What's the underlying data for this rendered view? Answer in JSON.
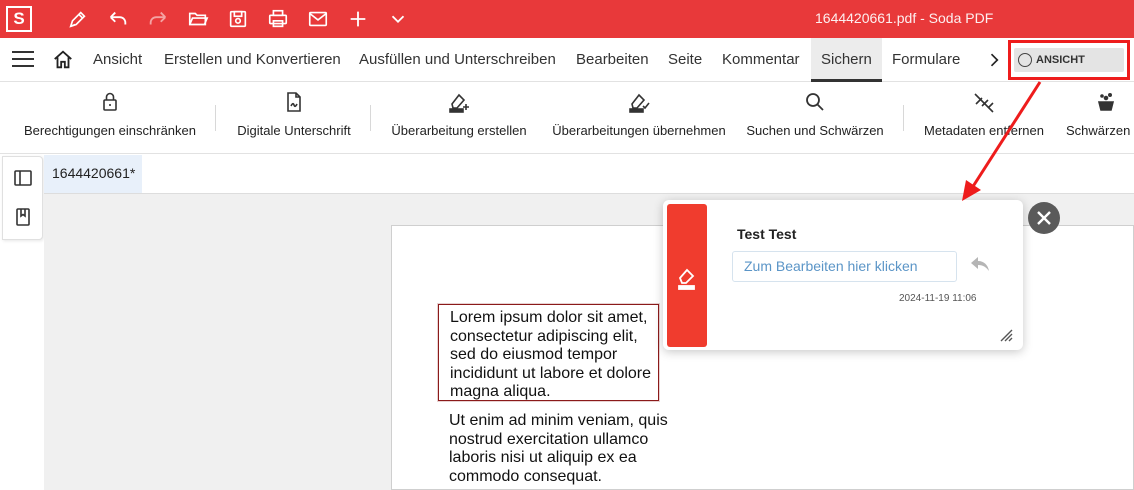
{
  "app": {
    "logo_letter": "S",
    "window_title": "1644420661.pdf  -  Soda PDF",
    "titlebar_color": "#e8393a",
    "quick_access_icons": [
      "pen-icon",
      "undo-icon",
      "redo-icon",
      "open-folder-icon",
      "save-icon",
      "print-icon",
      "mail-icon",
      "add-icon",
      "chevron-down-icon"
    ]
  },
  "menubar": {
    "tabs": [
      "Ansicht",
      "Erstellen und Konvertieren",
      "Ausfüllen und Unterschreiben",
      "Bearbeiten",
      "Seite",
      "Kommentar",
      "Sichern",
      "Formulare"
    ],
    "active_tab": "Sichern",
    "view_toggle_label": "ANSICHT"
  },
  "ribbon": {
    "tools": [
      {
        "label": "Berechtigungen einschränken",
        "icon": "lock-icon"
      },
      {
        "label": "Digitale Unterschrift",
        "icon": "signature-document-icon"
      },
      {
        "label": "Überarbeitung erstellen",
        "icon": "redact-add-icon"
      },
      {
        "label": "Überarbeitungen übernehmen",
        "icon": "redact-apply-icon"
      },
      {
        "label": "Suchen und Schwärzen",
        "icon": "search-icon"
      },
      {
        "label": "Metadaten entfernen",
        "icon": "remove-metadata-icon"
      },
      {
        "label": "Schwärzen",
        "icon": "sanitize-icon"
      }
    ]
  },
  "document": {
    "tab_name": "1644420661*",
    "paragraph1": "Lorem ipsum dolor sit amet, consectetur adipiscing elit, sed do eiusmod tempor incididunt ut labore et dolore magna aliqua.",
    "paragraph1_lines": [
      "Lorem ipsum dolor sit amet,",
      "consectetur adipiscing elit,",
      "sed do eiusmod tempor",
      "incididunt ut labore et dolore",
      "magna aliqua."
    ],
    "paragraph2_lines": [
      "Ut enim ad minim veniam, quis",
      "nostrud exercitation ullamco",
      "laboris nisi ut aliquip ex ea",
      "commodo consequat."
    ]
  },
  "annotation": {
    "author": "Test Test",
    "placeholder": "Zum Bearbeiten hier klicken",
    "date": "2024-11-19 11:06",
    "accent_color": "#f03c2e"
  },
  "highlight_color": "#ee1c1c"
}
